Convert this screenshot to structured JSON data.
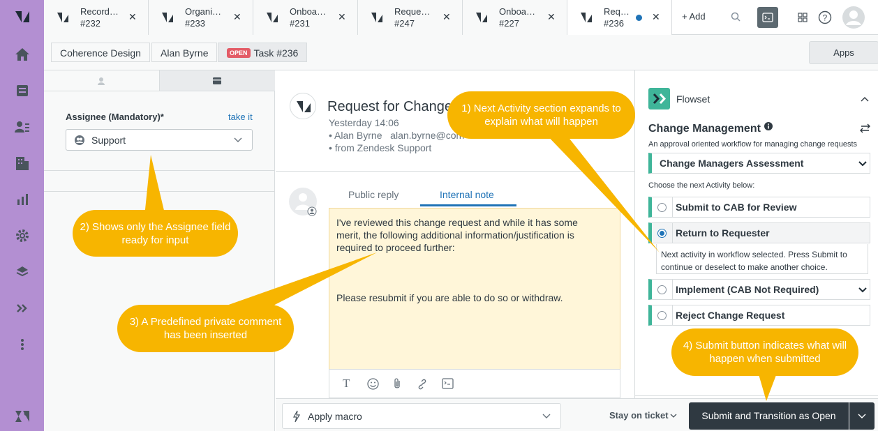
{
  "tabs": [
    {
      "title": "Record…",
      "id": "#232"
    },
    {
      "title": "Organi…",
      "id": "#233"
    },
    {
      "title": "Onboa…",
      "id": "#231"
    },
    {
      "title": "Reque…",
      "id": "#247"
    },
    {
      "title": "Onboa…",
      "id": "#227"
    },
    {
      "title": "Req…",
      "id": "#236"
    }
  ],
  "add_tab_label": "+ Add",
  "breadcrumb": {
    "org": "Coherence Design",
    "user": "Alan Byrne",
    "status_badge": "OPEN",
    "task": "Task #236"
  },
  "apps_label": "Apps",
  "assignee": {
    "label": "Assignee (Mandatory)*",
    "take_it": "take it",
    "value": "Support"
  },
  "ticket": {
    "title": "Request for Change",
    "time": "Yesterday 14:06",
    "from_line": "• Alan Byrne   alan.byrne@com",
    "via_line": "• from Zendesk Support"
  },
  "reply": {
    "tab_public": "Public reply",
    "tab_internal": "Internal note",
    "text_1": "I've reviewed this change request and while it has some merit, the following additional information/justification is required to proceed further:",
    "text_2": "Please resubmit if you are able to do so or withdraw."
  },
  "flowset": {
    "app_name": "Flowset",
    "workflow_title": "Change Management",
    "workflow_desc": "An approval oriented workflow for managing change requests",
    "state": "Change Managers Assessment",
    "choose_label": "Choose the next Activity below:",
    "activities": [
      {
        "label": "Submit to CAB for Review",
        "selected": false
      },
      {
        "label": "Return to Requester",
        "selected": true
      },
      {
        "label": "Implement (CAB Not Required)",
        "selected": false
      },
      {
        "label": "Reject Change Request",
        "selected": false
      }
    ],
    "next_info": "Next activity in workflow selected. Press Submit to continue or deselect to make another choice."
  },
  "bottom": {
    "macro": "Apply macro",
    "stay": "Stay on ticket",
    "submit": "Submit and Transition as Open"
  },
  "callouts": {
    "c1": "1) Next Activity section expands to explain what will happen",
    "c2": "2) Shows only the Assignee field ready for input",
    "c3": "3) A Predefined private comment has been inserted",
    "c4": "4) Submit button indicates what will happen when submitted"
  },
  "colors": {
    "nav": "#b38fd2",
    "accent": "#1f73b7",
    "teal": "#3fb599",
    "callout": "#f7b500",
    "submit": "#2f3941"
  }
}
